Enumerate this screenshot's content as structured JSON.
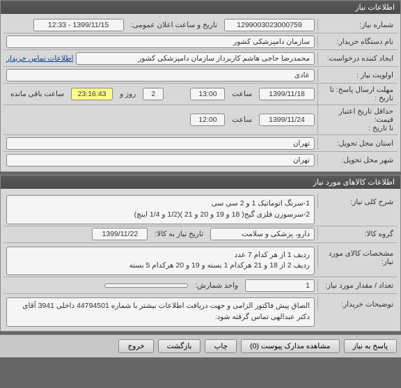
{
  "panel1": {
    "title": "اطلاعات نیاز",
    "rows": {
      "niaz_no_label": "شماره نیاز:",
      "niaz_no": "1299003023000759",
      "announce_label": "تاریخ و ساعت اعلان عمومی:",
      "announce_value": "1399/11/15 - 12:33",
      "org_label": "نام دستگاه خریدار:",
      "org_value": "سازمان دامپزشکی کشور",
      "creator_label": "ایجاد کننده درخواست:",
      "creator_value": "محمدرضا حاجی هاشم کاربرداز سازمان دامپزشکی کشور",
      "contact_link": "اطلاعات تماس خریدار",
      "priority_label": "اولویت نیاز :",
      "priority_value": "عادی",
      "deadline_label": "مهلت ارسال پاسخ: تا تاریخ :",
      "deadline_date": "1399/11/18",
      "time_label": "ساعت",
      "deadline_time": "13:00",
      "days_remaining": "2",
      "days_label": "روز و",
      "countdown": "23:16:43",
      "remain_label": "ساعت باقی مانده",
      "credit_label": "حداقل تاریخ اعتبار قیمت:",
      "credit_label2": "تا تاریخ :",
      "credit_date": "1399/11/24",
      "credit_time": "12:00",
      "deliver_label": "استان محل تحویل:",
      "deliver_province": "تهران",
      "deliver_city_label": "شهر محل تحویل:",
      "deliver_city": "تهران"
    }
  },
  "panel2": {
    "title": "اطلاعات کالاهای مورد نیاز",
    "rows": {
      "desc_label": "شرح کلی نیاز:",
      "desc_value": "1-سرنگ اتوماتیک 1 و 2 سی سی\n2-سرسوزن فلزی گیج( 18 و 19 و 20 و 21 )(1/2 و 1/4 اینچ)",
      "group_label": "گروه کالا:",
      "group_value": "دارو، پزشکی و سلامت",
      "need_date_label": "تاریخ نیاز به کالا:",
      "need_date": "1399/11/22",
      "spec_label": "مشخصات کالای مورد نیاز:",
      "spec_value": "ردیف 1 از هر کدام 7 عدد\nردیف 2 از 18 و 21 هرکدام 1 بسته و 19 و 20 هرکدام 5 بسته",
      "qty_label": "تعداد / مقدار مورد نیاز:",
      "qty_value": "1",
      "unit_label": "واحد شمارش:",
      "unit_value": "",
      "notes_label": "توضیحات خریدار:",
      "notes_value": "الصاق پیش فاکتور الزامی و جهت دریافت اطلاعات بیشتر با شماره 44794501 داخلی 3941 آقای دکتر عبدالهی تماس گرفته شود."
    }
  },
  "buttons": {
    "reply": "پاسخ به نیاز",
    "view_attach": "مشاهده مدارک پیوست (0)",
    "print": "چاپ",
    "back": "بازگشت",
    "exit": "خروج"
  }
}
